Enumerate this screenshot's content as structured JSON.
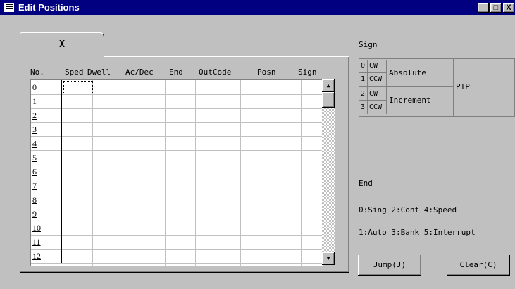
{
  "window": {
    "title": "Edit Positions",
    "minimize_label": "_",
    "maximize_label": "□",
    "close_label": "X"
  },
  "tab": {
    "label": "X"
  },
  "table": {
    "columns": [
      "No.",
      "Sped",
      "Dwell",
      "Ac/Dec",
      "End",
      "OutCode",
      "Posn",
      "Sign"
    ],
    "rows": [
      "0",
      "1",
      "2",
      "3",
      "4",
      "5",
      "6",
      "7",
      "8",
      "9",
      "10",
      "11",
      "12"
    ]
  },
  "sign": {
    "label": "Sign",
    "rows": [
      {
        "num": "0",
        "dir": "CW"
      },
      {
        "num": "1",
        "dir": "CCW"
      },
      {
        "num": "2",
        "dir": "CW"
      },
      {
        "num": "3",
        "dir": "CCW"
      }
    ],
    "absolute": "Absolute",
    "increment": "Increment",
    "mode": "PTP"
  },
  "end": {
    "label": "End",
    "line1": "0:Sing 2:Cont 4:Speed",
    "line2": "1:Auto 3:Bank 5:Interrupt"
  },
  "buttons": {
    "jump": "Jump(J)",
    "clear": "Clear(C)"
  },
  "scrollbar": {
    "up_icon": "▲",
    "down_icon": "▼"
  }
}
